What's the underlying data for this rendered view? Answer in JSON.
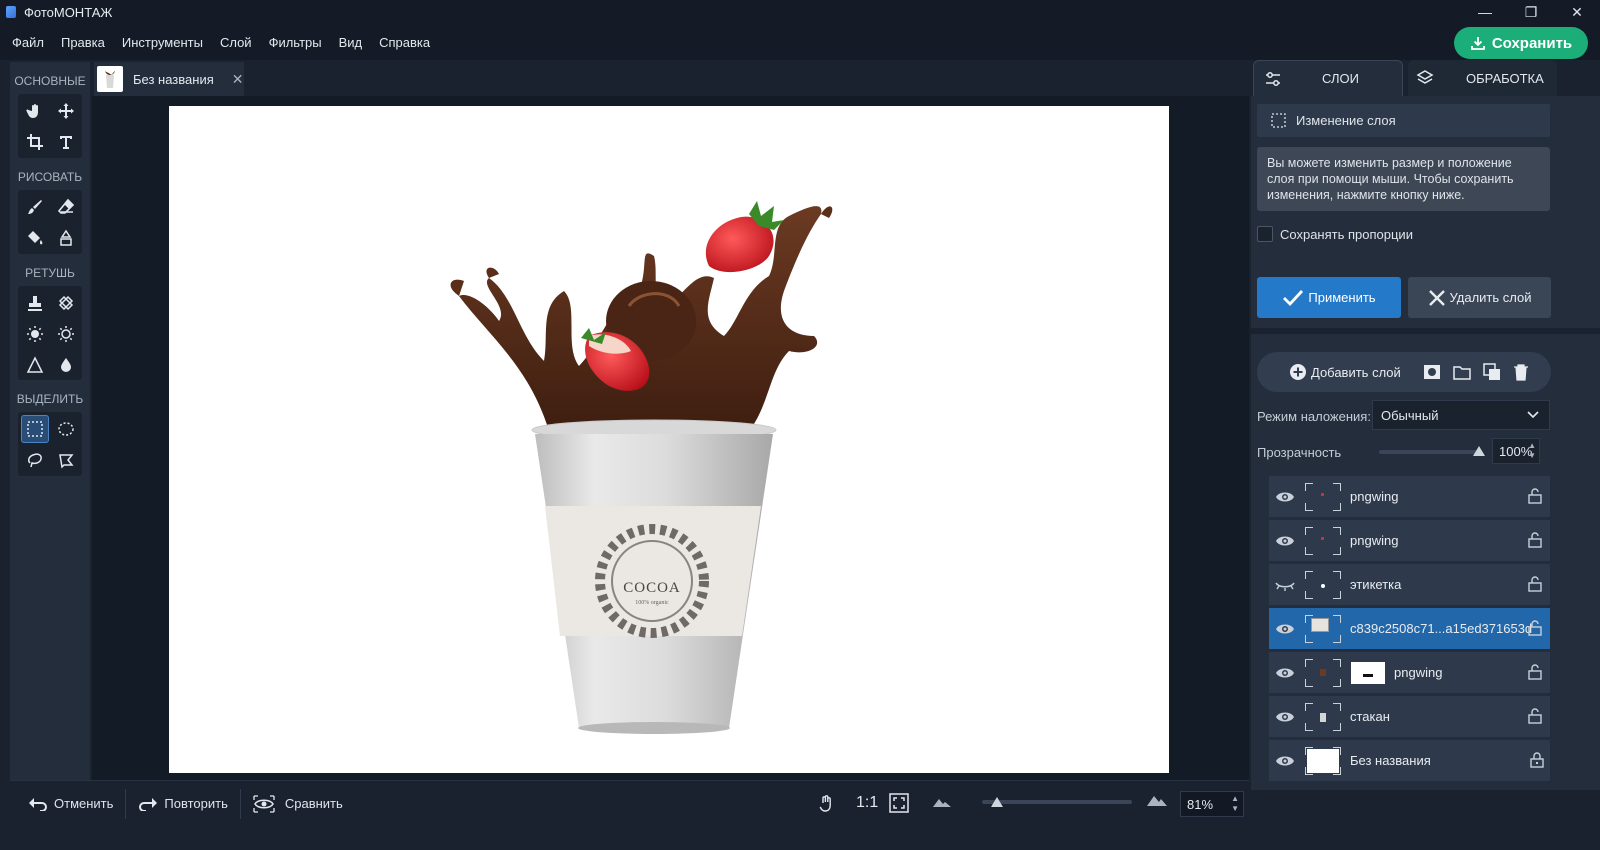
{
  "window": {
    "title": "ФотоМОНТАЖ",
    "minimize": "—",
    "restore": "❐",
    "close": "✕"
  },
  "menu": [
    "Файл",
    "Правка",
    "Инструменты",
    "Слой",
    "Фильтры",
    "Вид",
    "Справка"
  ],
  "save_button": "Сохранить",
  "toolbar": {
    "sections": [
      "ОСНОВНЫЕ",
      "РИСОВАТЬ",
      "РЕТУШЬ",
      "ВЫДЕЛИТЬ"
    ]
  },
  "document_tab": {
    "name": "Без названия",
    "close": "✕"
  },
  "canvas": {
    "label_text": "COCOA",
    "label_subtext": "100% organic"
  },
  "bottom": {
    "undo": "Отменить",
    "redo": "Повторить",
    "compare": "Сравнить",
    "one_to_one": "1:1",
    "zoom": "81%",
    "zoom_fraction": 0.1
  },
  "right_panel": {
    "tab_layers": "СЛОИ",
    "tab_processing": "ОБРАБОТКА",
    "layer_edit_title": "Изменение слоя",
    "hint": "Вы можете изменить размер и положение слоя при помощи мыши. Чтобы сохранить изменения, нажмите кнопку ниже.",
    "keep_proportions": "Сохранять пропорции",
    "apply": "Применить",
    "delete_layer": "Удалить слой",
    "add_layer": "Добавить слой",
    "blend_label": "Режим наложения:",
    "blend_value": "Обычный",
    "opacity_label": "Прозрачность",
    "opacity_value": "100%",
    "opacity_fraction": 1.0
  },
  "layers": [
    {
      "name": "pngwing",
      "visible": true,
      "locked": false,
      "selected": false
    },
    {
      "name": "pngwing",
      "visible": true,
      "locked": false,
      "selected": false
    },
    {
      "name": "этикетка",
      "visible": false,
      "locked": false,
      "selected": false
    },
    {
      "name": "c839c2508c71...a15ed371653d",
      "visible": true,
      "locked": false,
      "selected": true
    },
    {
      "name": "pngwing",
      "visible": true,
      "locked": false,
      "selected": false
    },
    {
      "name": "стакан",
      "visible": true,
      "locked": false,
      "selected": false
    },
    {
      "name": "Без названия",
      "visible": true,
      "locked": true,
      "selected": false
    }
  ],
  "colors": {
    "accent_green": "#1bae79",
    "accent_blue": "#2579c9",
    "selected_layer": "#2267aa"
  }
}
